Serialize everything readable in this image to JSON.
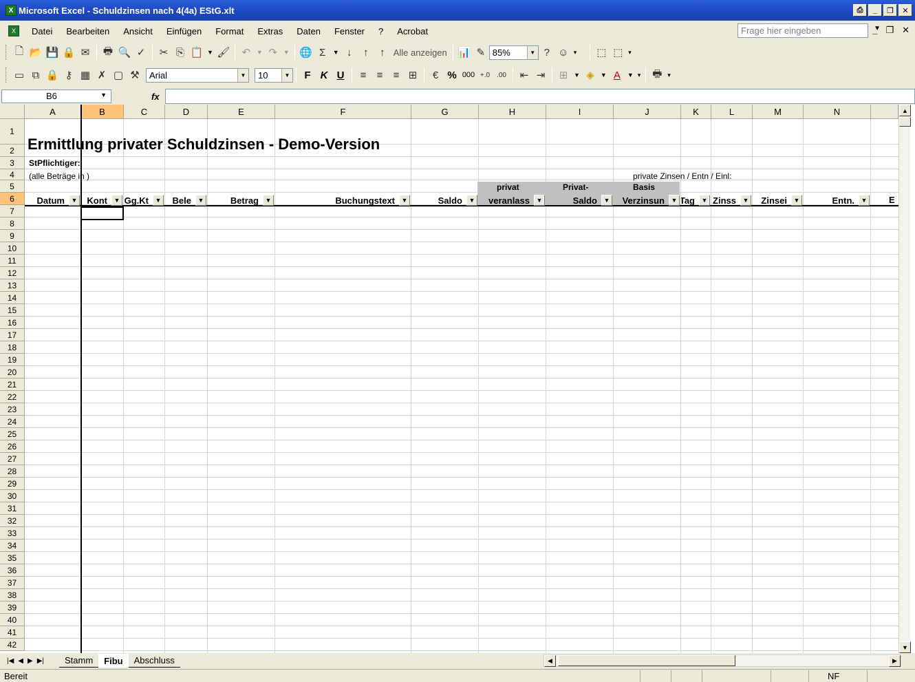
{
  "window": {
    "title": "Microsoft Excel - Schuldzinsen nach 4(4a) EStG.xlt"
  },
  "menu": [
    "Datei",
    "Bearbeiten",
    "Ansicht",
    "Einfügen",
    "Format",
    "Extras",
    "Daten",
    "Fenster",
    "?",
    "Acrobat"
  ],
  "help_placeholder": "Frage hier eingeben",
  "toolbar": {
    "show_all": "Alle anzeigen",
    "zoom": "85%",
    "font": "Arial",
    "size": "10",
    "bold": "F",
    "italic": "K",
    "underline": "U",
    "percent": "%",
    "thousands": "000"
  },
  "formula_bar": {
    "namebox": "B6",
    "fx": "fx",
    "content": ""
  },
  "columns": [
    "A",
    "B",
    "C",
    "D",
    "E",
    "F",
    "G",
    "H",
    "I",
    "J",
    "K",
    "L",
    "M",
    "N"
  ],
  "rows": [
    "1",
    "2",
    "3",
    "4",
    "5",
    "6",
    "7",
    "8",
    "9",
    "10",
    "11",
    "12",
    "13",
    "14",
    "15",
    "16",
    "17",
    "18",
    "19",
    "20",
    "21",
    "22",
    "23",
    "24",
    "25",
    "26",
    "27",
    "28",
    "29",
    "30",
    "31",
    "32",
    "33",
    "34",
    "35",
    "36",
    "37",
    "38",
    "39",
    "40",
    "41",
    "42"
  ],
  "sheet": {
    "title": "Ermittlung privater Schuldzinsen - Demo-Version",
    "taxpayer_label": "StPflichtiger:",
    "amounts_note": "(alle Beträge in )",
    "private_note": "private Zinsen / Entn / Einl:",
    "h4_header": "privat",
    "i4_header": "Privat-",
    "j4_header": "Basis",
    "headers": [
      "Datum",
      "Kont",
      "Gg.Kt",
      "Bele",
      "Betrag",
      "Buchungstext",
      "Saldo",
      "veranlass",
      "Saldo",
      "Verzinsun",
      "Tag",
      "Zinss",
      "Zinsei",
      "Entn.",
      "E"
    ]
  },
  "tabs": [
    "Stamm",
    "Fibu",
    "Abschluss"
  ],
  "active_tab": "Fibu",
  "status": {
    "left": "Bereit",
    "nf": "NF"
  },
  "colors": {
    "title_bar": "#1f4bc4",
    "selection_header": "#ffc47a",
    "chrome": "#ece9d8"
  }
}
